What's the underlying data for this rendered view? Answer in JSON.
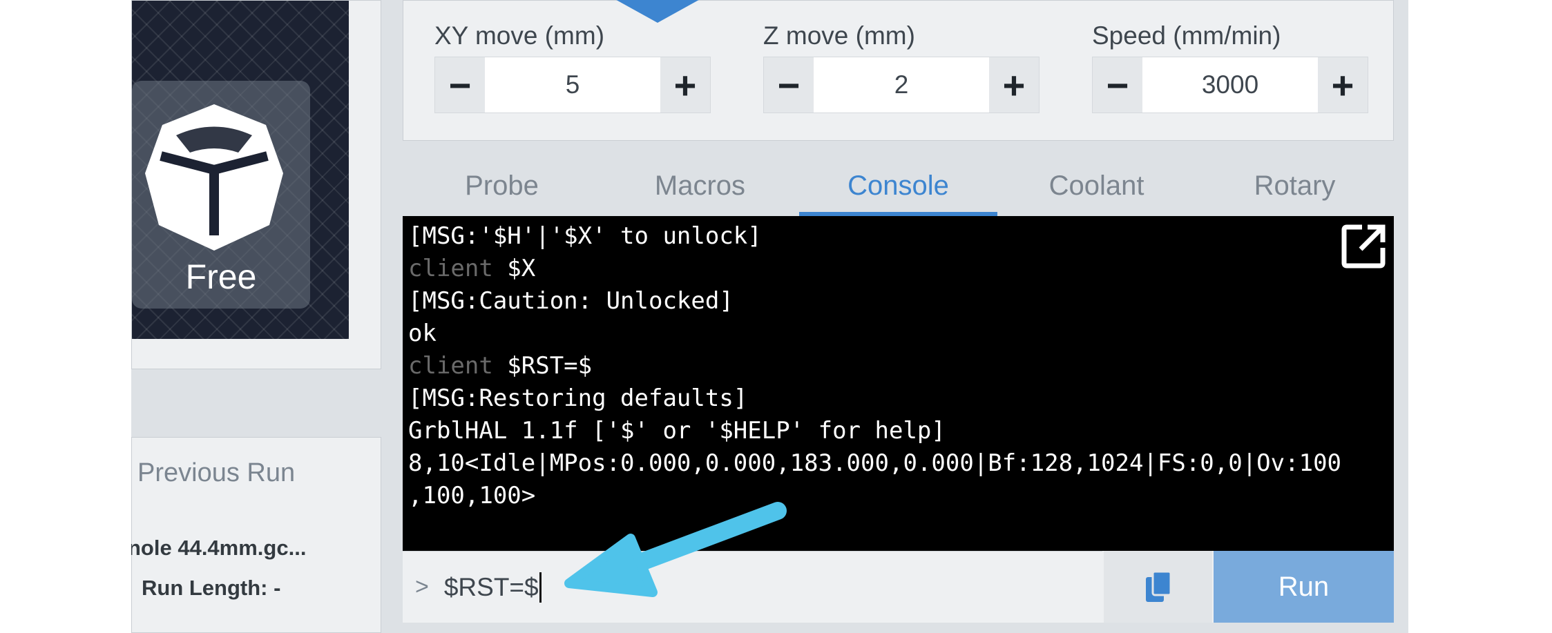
{
  "sidebar": {
    "free_label": "Free",
    "previous_run": {
      "title": "Previous Run",
      "file": "nole 44.4mm.gc...",
      "run_length": "Run Length: -"
    }
  },
  "jog": {
    "xy": {
      "label": "XY move (mm)",
      "value": "5",
      "minus": "−",
      "plus": "+"
    },
    "z": {
      "label": "Z move (mm)",
      "value": "2",
      "minus": "−",
      "plus": "+"
    },
    "speed": {
      "label": "Speed (mm/min)",
      "value": "3000",
      "minus": "−",
      "plus": "+"
    }
  },
  "tabs": [
    {
      "label": "Probe"
    },
    {
      "label": "Macros"
    },
    {
      "label": "Console"
    },
    {
      "label": "Coolant"
    },
    {
      "label": "Rotary"
    }
  ],
  "console": {
    "lines": [
      {
        "text": "[MSG:'$H'|'$X' to unlock]"
      },
      {
        "prefix": "client ",
        "text": "$X"
      },
      {
        "text": "[MSG:Caution: Unlocked]"
      },
      {
        "text": "ok"
      },
      {
        "prefix": "client ",
        "text": "$RST=$"
      },
      {
        "text": "[MSG:Restoring defaults]"
      },
      {
        "text": "GrblHAL 1.1f ['$' or '$HELP' for help]"
      },
      {
        "text": "8,10<Idle|MPos:0.000,0.000,183.000,0.000|Bf:128,1024|FS:0,0|Ov:100"
      },
      {
        "text": ",100,100>"
      }
    ],
    "prompt": ">",
    "input_value": "$RST=$",
    "run_label": "Run"
  },
  "icons": {
    "cube": "cube-icon",
    "popout": "external-link-icon",
    "copy": "copy-icon",
    "jog_arrow": "arrow-down-icon"
  },
  "colors": {
    "accent": "#3d85d0",
    "run_button": "#79aadc",
    "console_bg": "#000000",
    "annotation_arrow": "#4fc3ea"
  }
}
